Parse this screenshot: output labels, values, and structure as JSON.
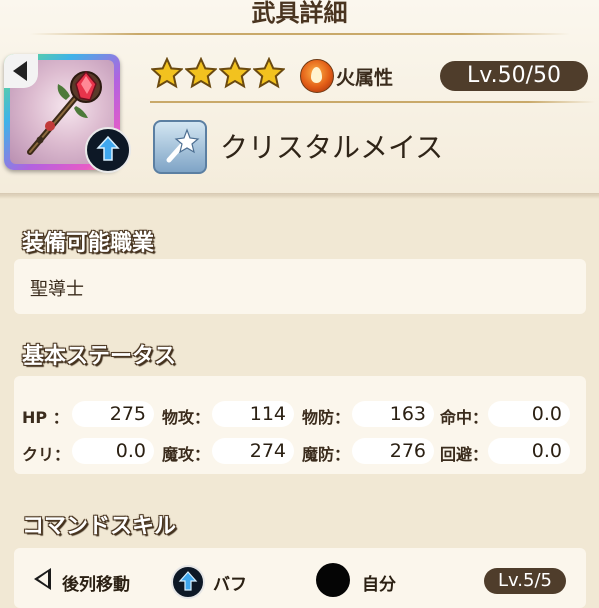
{
  "header": {
    "title": "武具詳細"
  },
  "weapon": {
    "rarity_stars": 4,
    "element_label": "火属性",
    "level": "Lv.50/50",
    "name": "クリスタルメイス"
  },
  "sections": {
    "jobs_title": "装備可能職業",
    "job": "聖導士",
    "stats_title": "基本ステータス",
    "skills_title": "コマンドスキル"
  },
  "stats": [
    {
      "label": "HP ：",
      "value": "275"
    },
    {
      "label": "物攻：",
      "value": "114"
    },
    {
      "label": "物防：",
      "value": "163"
    },
    {
      "label": "命中：",
      "value": "0.0"
    },
    {
      "label": "クリ：",
      "value": "0.0"
    },
    {
      "label": "魔攻：",
      "value": "274"
    },
    {
      "label": "魔防：",
      "value": "276"
    },
    {
      "label": "回避：",
      "value": "0.0"
    }
  ],
  "skill": {
    "move": "後列移動",
    "type": "バフ",
    "target": "自分",
    "level": "Lv.5/5"
  },
  "colors": {
    "background": "#f1e8d4",
    "panel": "#fbf6ec",
    "pill": "#4f3d2b",
    "star": "#f2c21f",
    "fire": "#e25d16"
  },
  "icons": [
    "back-arrow-icon",
    "buff-arrow-icon",
    "star-icon",
    "fire-element-icon",
    "mace-type-icon",
    "self-target-icon"
  ]
}
